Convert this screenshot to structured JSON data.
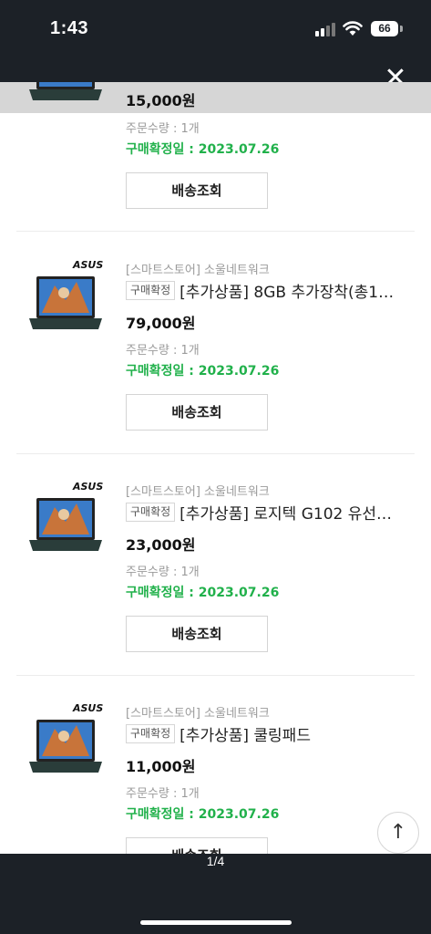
{
  "status": {
    "time": "1:43",
    "battery": "66"
  },
  "viewer": {
    "close_icon": "close-icon",
    "page_indicator": "1/4"
  },
  "orders": [
    {
      "price": "15,000원",
      "quantity": "주문수량 : 1개",
      "confirm_date": "구매확정일 : 2023.07.26",
      "button": "배송조회"
    },
    {
      "brand": "ASUS",
      "seller": "[스마트스토어] 소울네트워크",
      "badge": "구매확정",
      "name": "[추가상품] 8GB 추가장착(총1…",
      "price": "79,000원",
      "quantity": "주문수량 : 1개",
      "confirm_date": "구매확정일 : 2023.07.26",
      "button": "배송조회"
    },
    {
      "brand": "ASUS",
      "seller": "[스마트스토어] 소울네트워크",
      "badge": "구매확정",
      "name": "[추가상품] 로지텍 G102 유선…",
      "price": "23,000원",
      "quantity": "주문수량 : 1개",
      "confirm_date": "구매확정일 : 2023.07.26",
      "button": "배송조회"
    },
    {
      "brand": "ASUS",
      "seller": "[스마트스토어] 소울네트워크",
      "badge": "구매확정",
      "name": "[추가상품] 쿨링패드",
      "price": "11,000원",
      "quantity": "주문수량 : 1개",
      "confirm_date": "구매확정일 : 2023.07.26",
      "button": "배송조회"
    }
  ],
  "colors": {
    "confirm_green": "#21b14b",
    "dark_bg": "#1c2127"
  }
}
